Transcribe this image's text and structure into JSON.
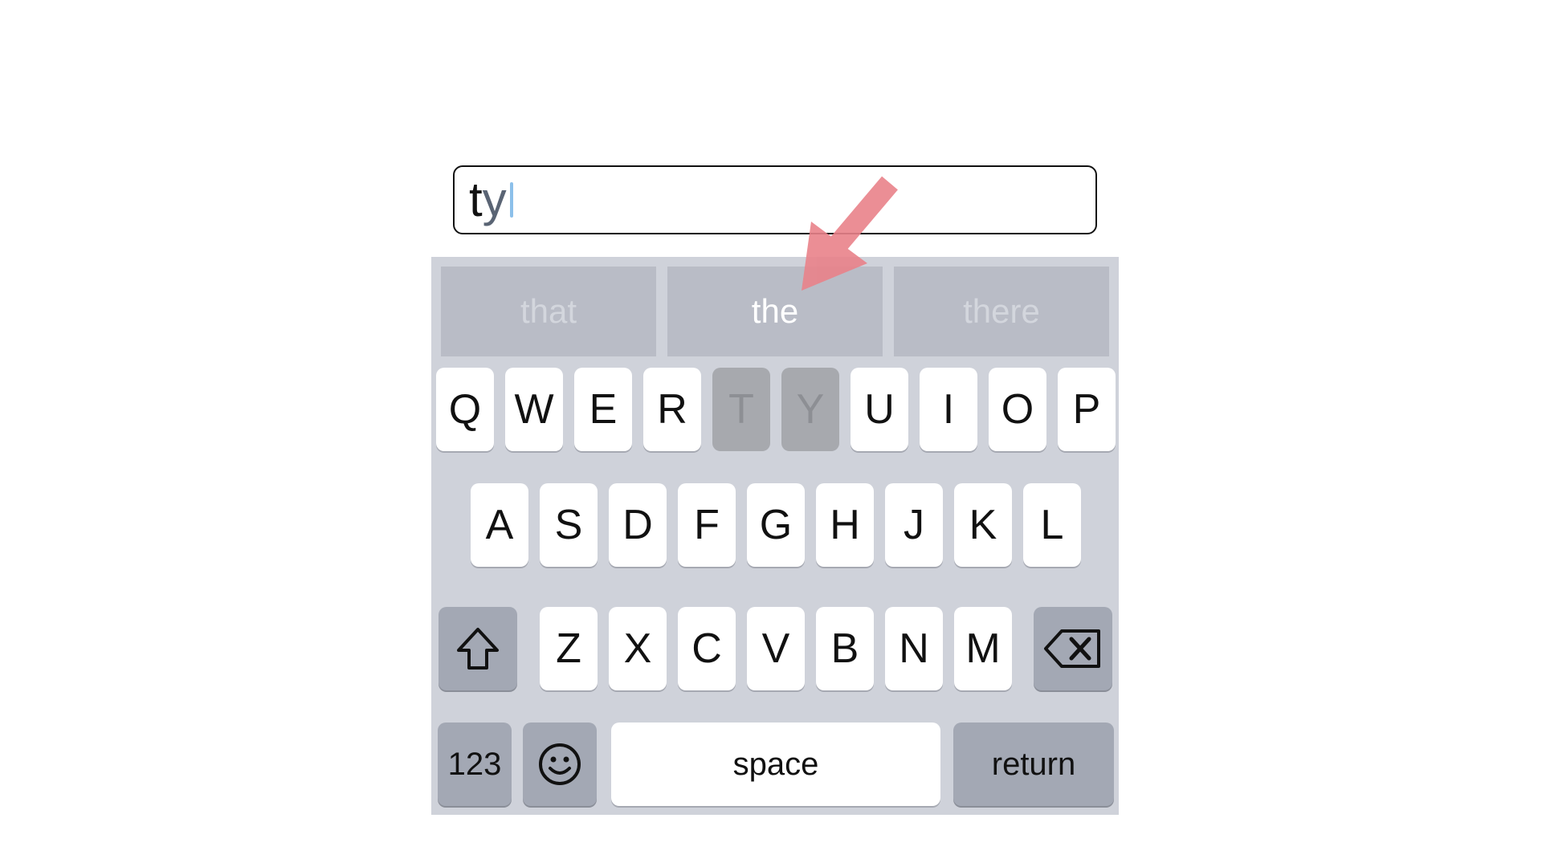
{
  "text_field": {
    "typed": "t",
    "pending": "y"
  },
  "suggestions": [
    "that",
    "the",
    "there"
  ],
  "keyboard": {
    "row1": [
      "Q",
      "W",
      "E",
      "R",
      "T",
      "Y",
      "U",
      "I",
      "O",
      "P"
    ],
    "row2": [
      "A",
      "S",
      "D",
      "F",
      "G",
      "H",
      "J",
      "K",
      "L"
    ],
    "row3": [
      "Z",
      "X",
      "C",
      "V",
      "B",
      "N",
      "M"
    ],
    "numbers_label": "123",
    "space_label": "space",
    "return_label": "return",
    "pressed_keys": [
      "T",
      "Y"
    ],
    "icons": {
      "shift": "shift-arrow-icon",
      "delete": "backspace-icon",
      "emoji": "smiley-face-icon"
    }
  },
  "annotation": {
    "arrow_color": "#e9828a",
    "points_to": "the"
  },
  "colors": {
    "keyboard_bg": "#cfd2da",
    "suggestion_bg": "#b9bcc6",
    "modifier_key_bg": "#a3a8b4",
    "cursor": "#8cc0ea"
  }
}
